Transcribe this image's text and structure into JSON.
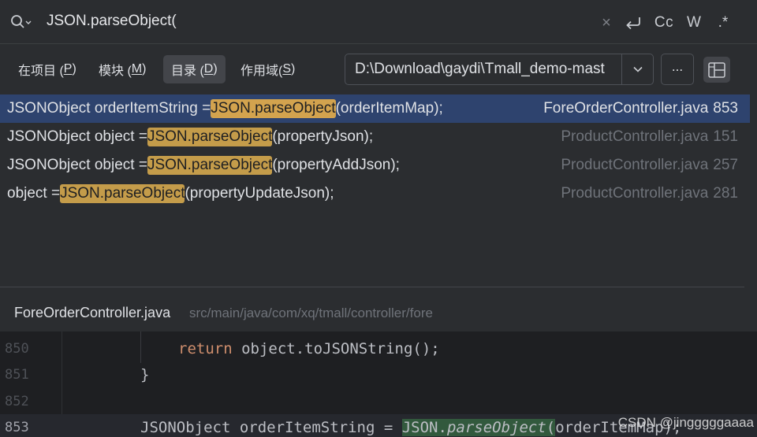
{
  "search": {
    "query": "JSON.parseObject(",
    "clear_icon": "×",
    "newline_icon": "newline-icon",
    "case_label": "Cc",
    "word_label": "W",
    "regex_label": ".*"
  },
  "scope": {
    "tabs": [
      {
        "label": "在项目 (",
        "key": "P",
        "suffix": ")",
        "active": false
      },
      {
        "label": "模块 (",
        "key": "M",
        "suffix": ")",
        "active": false
      },
      {
        "label": "目录 (",
        "key": "D",
        "suffix": ")",
        "active": true
      },
      {
        "label": "作用域(",
        "key": "S",
        "suffix": ")",
        "active": false
      }
    ],
    "directory": "D:\\Download\\gaydi\\Tmall_demo-mast",
    "browse_label": "..."
  },
  "results": [
    {
      "pre": "JSONObject orderItemString = ",
      "match": "JSON.parseObject",
      "post": "(orderItemMap);",
      "file": "ForeOrderController.java",
      "line": "853",
      "selected": true
    },
    {
      "pre": "JSONObject object = ",
      "match": "JSON.parseObject",
      "post": "(propertyJson);",
      "file": "ProductController.java",
      "line": "151",
      "selected": false
    },
    {
      "pre": "JSONObject object = ",
      "match": "JSON.parseObject",
      "post": "(propertyAddJson);",
      "file": "ProductController.java",
      "line": "257",
      "selected": false
    },
    {
      "pre": "object = ",
      "match": "JSON.parseObject",
      "post": "(propertyUpdateJson);",
      "file": "ProductController.java",
      "line": "281",
      "selected": false
    }
  ],
  "preview": {
    "file": "ForeOrderController.java",
    "path": "src/main/java/com/xq/tmall/controller/fore"
  },
  "editor": {
    "lines": [
      {
        "num": "850",
        "kw": "return",
        "text": " object.toJSONString();"
      },
      {
        "num": "851",
        "text": "}"
      },
      {
        "num": "852",
        "text": ""
      },
      {
        "num": "853",
        "pre": "JSONObject orderItemString = ",
        "m1": "JSON.",
        "m2": "parseObject",
        "m3": "(",
        "post": "orderItemMap);"
      }
    ],
    "watermark": "CSDN @jingggggaaaa"
  },
  "colors": {
    "selected_row": "#2e436e",
    "match_highlight": "#c49c4a",
    "editor_match": "#32593d"
  }
}
